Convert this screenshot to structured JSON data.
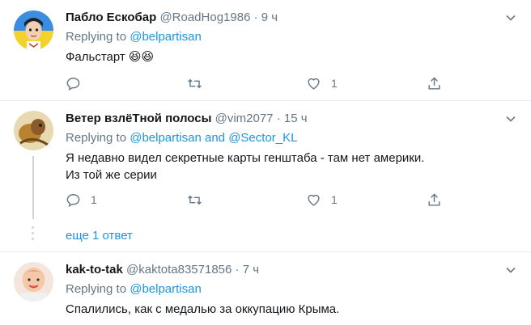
{
  "tweets": [
    {
      "name": "Пабло Ескобар",
      "handle": "@RoadHog1986",
      "time": "· 9 ч",
      "replying_prefix": "Replying to ",
      "replying_to": "@belpartisan",
      "replying_to_2": "",
      "text_line1": "Фальстарт",
      "emoji": "😆😆",
      "reply_count": "",
      "retweet_count": "",
      "like_count": "1"
    },
    {
      "name": "Ветер взлёТной полосы",
      "handle": "@vim2077",
      "time": "· 15 ч",
      "replying_prefix": "Replying to ",
      "replying_to": "@belpartisan",
      "replying_and": " and ",
      "replying_to_2": "@Sector_KL",
      "text_line1": "Я недавно видел секретные карты генштаба - там нет америки.",
      "text_line2": "Из той же серии",
      "reply_count": "1",
      "retweet_count": "",
      "like_count": "1"
    },
    {
      "name": "kak-to-tak",
      "handle": "@kaktota83571856",
      "time": "· 7 ч",
      "replying_prefix": "Replying to ",
      "replying_to": "@belpartisan",
      "text_line1": "Спалились, как с медалью за оккупацию Крыма."
    }
  ],
  "more_replies": "еще 1 ответ",
  "icons": {
    "reply": "reply-icon",
    "retweet": "retweet-icon",
    "like": "heart-icon",
    "share": "share-icon",
    "caret": "chevron-down-icon"
  },
  "colors": {
    "link": "#1b95e0",
    "muted": "#657786",
    "text": "#14171a",
    "divider": "#e6ecf0"
  }
}
